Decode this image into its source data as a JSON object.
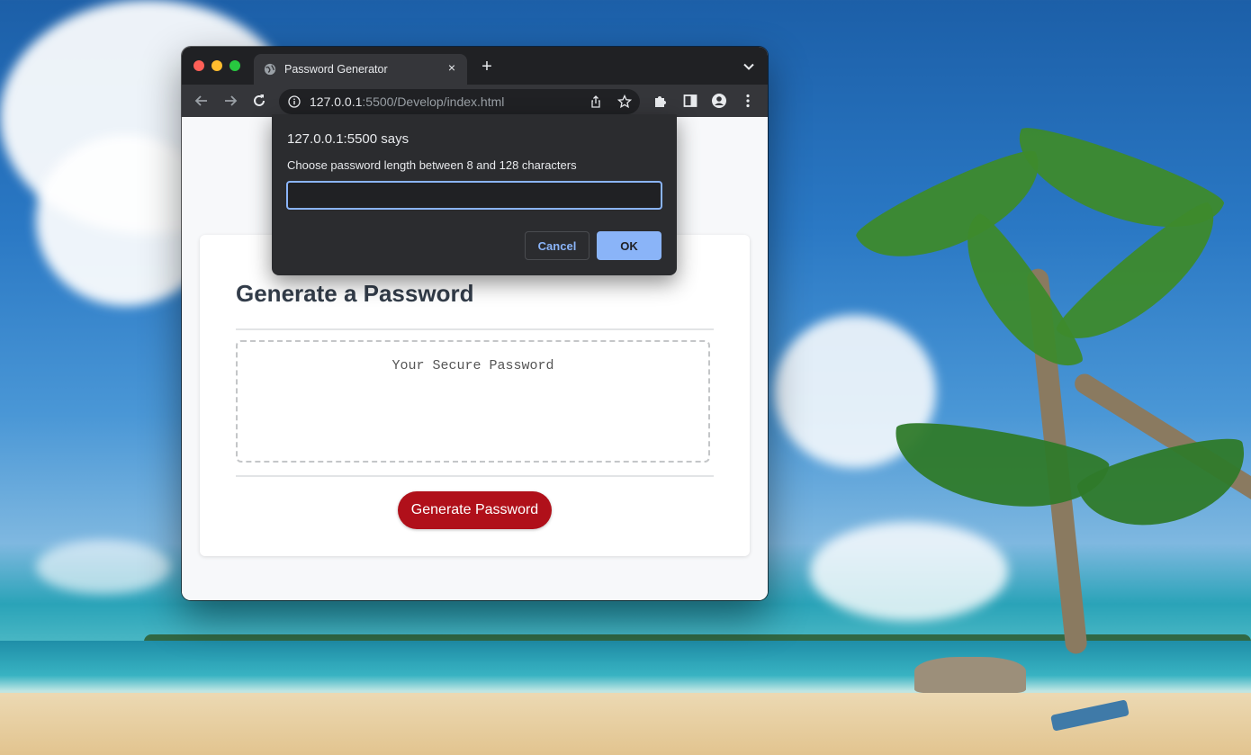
{
  "browser": {
    "tab": {
      "title": "Password Generator",
      "close_glyph": "×",
      "icon": "globe-icon"
    },
    "new_tab_glyph": "+",
    "address": {
      "host": "127.0.0.1",
      "path": ":5500/Develop/index.html"
    },
    "icons": [
      "back-arrow-icon",
      "forward-arrow-icon",
      "reload-icon",
      "info-icon",
      "share-icon",
      "bookmark-star-icon",
      "extensions-puzzle-icon",
      "side-panel-icon",
      "profile-icon",
      "menu-kebab-icon",
      "tab-list-chevron-icon"
    ]
  },
  "page": {
    "title": "Generate a Password",
    "password_placeholder": "Your Secure Password",
    "generate_label": "Generate Password"
  },
  "dialog": {
    "title": "127.0.0.1:5500 says",
    "message": "Choose password length between 8 and 128 characters",
    "input_value": "",
    "cancel_label": "Cancel",
    "ok_label": "OK"
  },
  "colors": {
    "accent_button": "#b0101a",
    "dialog_ok": "#8ab4f8",
    "chrome_dark": "#202124"
  }
}
